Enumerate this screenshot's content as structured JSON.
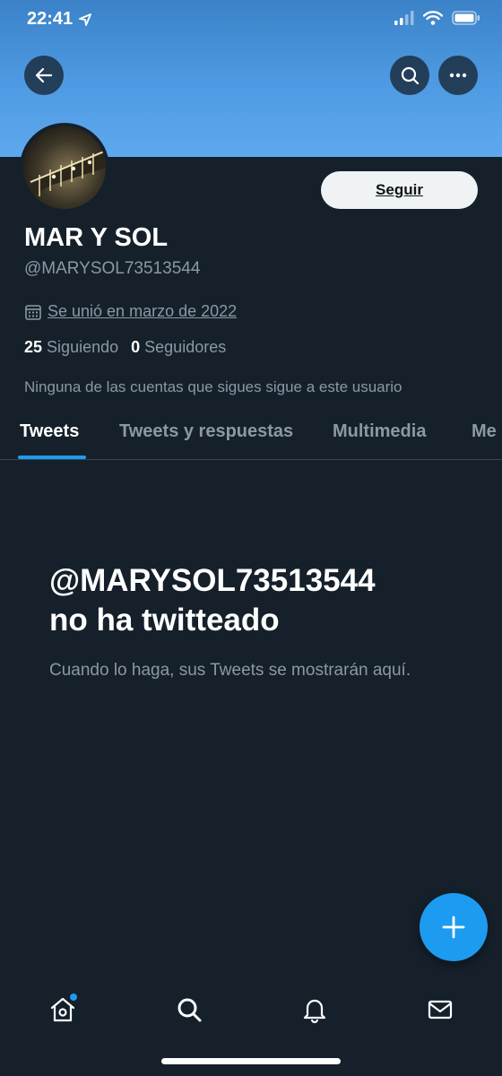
{
  "status_bar": {
    "time": "22:41"
  },
  "profile": {
    "display_name": "MAR Y SOL",
    "handle": "@MARYSOL73513544",
    "joined": "Se unió en marzo de 2022",
    "following_count": "25",
    "following_label": "Siguiendo",
    "followers_count": "0",
    "followers_label": "Seguidores",
    "followers_note": "Ninguna de las cuentas que sigues sigue a este usuario",
    "follow_label": "Seguir"
  },
  "tabs": [
    {
      "label": "Tweets",
      "active": true
    },
    {
      "label": "Tweets y respuestas",
      "active": false
    },
    {
      "label": "Multimedia",
      "active": false
    },
    {
      "label": "Me",
      "active": false
    }
  ],
  "empty_state": {
    "title_line1": "@MARYSOL73513544",
    "title_line2": "no ha twitteado",
    "description": "Cuando lo haga, sus Tweets se mostrarán aquí."
  },
  "icons": {
    "back": "back-arrow-icon",
    "search": "search-icon",
    "more": "more-icon",
    "compose": "plus-icon",
    "home": "home-icon",
    "explore": "search-icon",
    "notifications": "bell-icon",
    "messages": "mail-icon"
  },
  "colors": {
    "background": "#15202b",
    "banner": "#4f9be3",
    "accent": "#1d9bf0",
    "secondary_text": "#8b98a5"
  }
}
